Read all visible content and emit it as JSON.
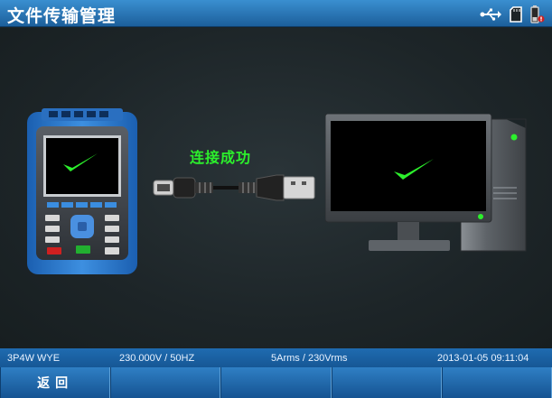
{
  "header": {
    "title": "文件传输管理",
    "status_icons": [
      "usb-icon",
      "sd-card-icon",
      "battery-warning-icon"
    ]
  },
  "main": {
    "connection_status": "连接成功",
    "status_color": "#2cf02c"
  },
  "info_bar": {
    "wiring": "3P4W WYE",
    "voltage": "230.000V / 50HZ",
    "current": "5Arms / 230Vrms",
    "datetime": "2013-01-05 09:11:04"
  },
  "softkeys": {
    "back_label": "返回"
  },
  "colors": {
    "accent": "#1f6bb0",
    "check": "#2cf02c"
  }
}
